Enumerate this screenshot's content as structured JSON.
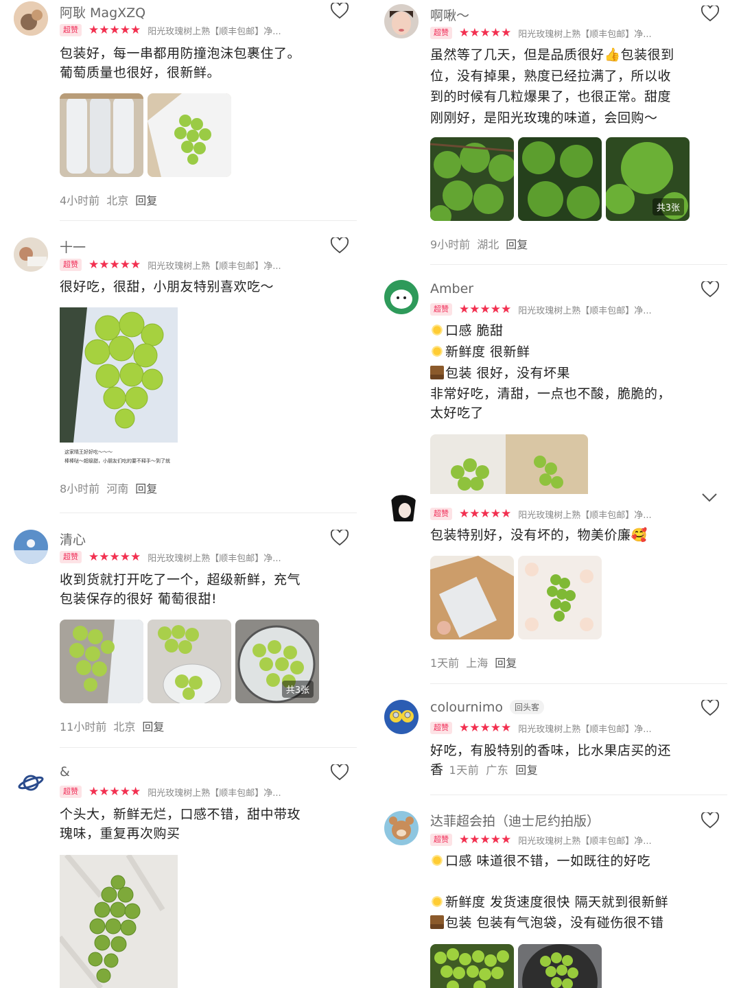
{
  "badge_label": "超赞",
  "stars_text": "★★★★★",
  "product_title": "阳光玫瑰树上熟【顺丰包邮】净...",
  "reply_label": "回复",
  "left": [
    {
      "name": "阿耿 MagXZQ",
      "text": [
        "包装好，每一串都用防撞泡沫包裹住了。",
        "葡萄质量也很好，很新鲜。"
      ],
      "time": "4小时前",
      "location": "北京"
    },
    {
      "name": "十一",
      "text": [
        "很好吃，很甜，小朋友特别喜欢吃～"
      ],
      "caption": [
        "这家晴王好好吃～～～",
        "棒棒哒～超级甜，小朋友们吃的要不释手～到了就"
      ],
      "time": "8小时前",
      "location": "河南"
    },
    {
      "name": "清心",
      "text": [
        "收到货就打开吃了一个，超级新鲜，充气",
        "包装保存的很好 葡萄很甜!"
      ],
      "image_count": "共3张",
      "time": "11小时前",
      "location": "北京"
    },
    {
      "name": "&",
      "text": [
        "个头大，新鲜无烂，口感不错，甜中带玫",
        "瑰味，重复再次购买"
      ]
    }
  ],
  "right": [
    {
      "name": "啊啾～",
      "text": [
        "虽然等了几天，但是品质很好👍包装很到",
        "位，没有掉果，熟度已经拉满了，所以收",
        "到的时候有几粒爆果了，也很正常。甜度",
        "刚刚好，是阳光玫瑰的味道，会回购～"
      ],
      "image_count": "共3张",
      "time": "9小时前",
      "location": "湖北"
    },
    {
      "name": "Amber",
      "attr1": "口感 脆甜",
      "attr2": "新鲜度 很新鲜",
      "attr3": "包装 很好，没有坏果",
      "text": [
        "非常好吃，清甜，一点也不酸，脆脆的，",
        "太好吃了"
      ]
    },
    {
      "text": [
        "包装特别好，没有坏的，物美价廉🥰"
      ],
      "time": "1天前",
      "location": "上海"
    },
    {
      "name": "colournimo",
      "tag": "回头客",
      "text": [
        "好吃，有股特别的香味，比水果店买的还"
      ],
      "text_last": "香",
      "time": "1天前",
      "location": "广东"
    },
    {
      "name": "达菲超会拍（迪士尼约拍版）",
      "attr1": "口感 味道很不错，一如既往的好吃",
      "attr2": "新鲜度 发货速度很快 隔天就到很新鲜",
      "attr3": "包装 包装有气泡袋，没有碰伤很不错"
    }
  ],
  "colors": {
    "accent": "#f23050",
    "badge_bg": "#fde3e6",
    "grape": "#8cc63f"
  }
}
